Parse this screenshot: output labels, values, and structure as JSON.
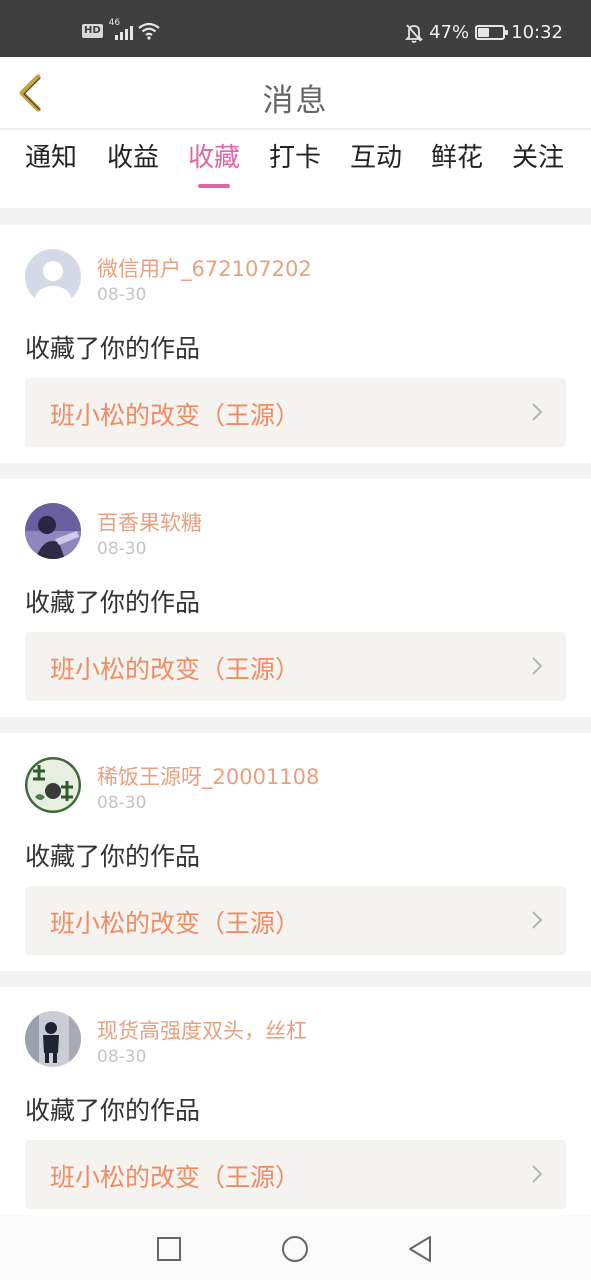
{
  "status_bar": {
    "network_badge": "HD",
    "network_type": "46",
    "battery_percent": "47%",
    "battery_level": 0.47,
    "time": "10:32"
  },
  "header": {
    "title": "消息",
    "back_icon": "chevron-left-icon"
  },
  "tabs": [
    {
      "label": "通知",
      "active": false
    },
    {
      "label": "收益",
      "active": false
    },
    {
      "label": "收藏",
      "active": true
    },
    {
      "label": "打卡",
      "active": false
    },
    {
      "label": "互动",
      "active": false
    },
    {
      "label": "鲜花",
      "active": false
    },
    {
      "label": "关注",
      "active": false
    }
  ],
  "feed": [
    {
      "username": "微信用户_672107202",
      "date": "08-30",
      "action": "收藏了你的作品",
      "work_title": "班小松的改变（王源）",
      "avatar": "default-avatar"
    },
    {
      "username": "百香果软糖",
      "date": "08-30",
      "action": "收藏了你的作品",
      "work_title": "班小松的改变（王源）",
      "avatar": "photo-avatar"
    },
    {
      "username": "稀饭王源呀_20001108",
      "date": "08-30",
      "action": "收藏了你的作品",
      "work_title": "班小松的改变（王源）",
      "avatar": "photo-avatar"
    },
    {
      "username": "现货高强度双头，丝杠",
      "date": "08-30",
      "action": "收藏了你的作品",
      "work_title": "班小松的改变（王源）",
      "avatar": "photo-avatar"
    }
  ],
  "nav_bar": {
    "recents_icon": "square-icon",
    "home_icon": "circle-icon",
    "back_icon": "triangle-back-icon"
  },
  "colors": {
    "accent": "#e065a4",
    "username": "#e8a07e",
    "work_title": "#f08c62"
  }
}
